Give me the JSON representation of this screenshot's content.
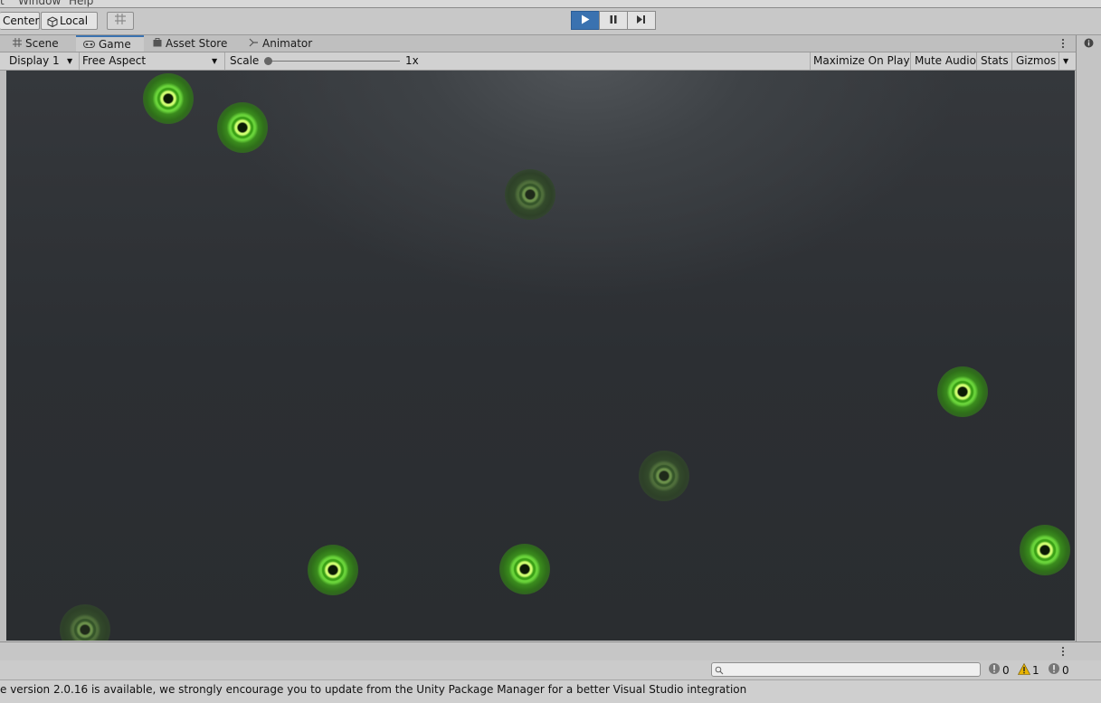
{
  "menu": {
    "items": [
      "t",
      "Window",
      "Help"
    ]
  },
  "toolbar": {
    "pivot_label": "Center",
    "space_label": "Local"
  },
  "tabs": [
    {
      "label": "Scene",
      "icon": "grid-icon"
    },
    {
      "label": "Game",
      "icon": "gamepad-icon",
      "active": true
    },
    {
      "label": "Asset Store",
      "icon": "bag-icon"
    },
    {
      "label": "Animator",
      "icon": "animator-icon"
    }
  ],
  "gamebar": {
    "display": "Display 1",
    "aspect": "Free Aspect",
    "scale_label": "Scale",
    "scale_value": "1x",
    "maximize": "Maximize On Play",
    "mute": "Mute Audio",
    "stats": "Stats",
    "gizmos": "Gizmos"
  },
  "console": {
    "search_placeholder": "",
    "info_count": "0",
    "warning_count": "1",
    "error_count": "0"
  },
  "status": {
    "message": "e version 2.0.16 is available, we strongly encourage you to update from the Unity Package Manager for a better Visual Studio integration"
  },
  "colors": {
    "play_active": "#3a72b0",
    "orb_green": "#6ee23a"
  }
}
